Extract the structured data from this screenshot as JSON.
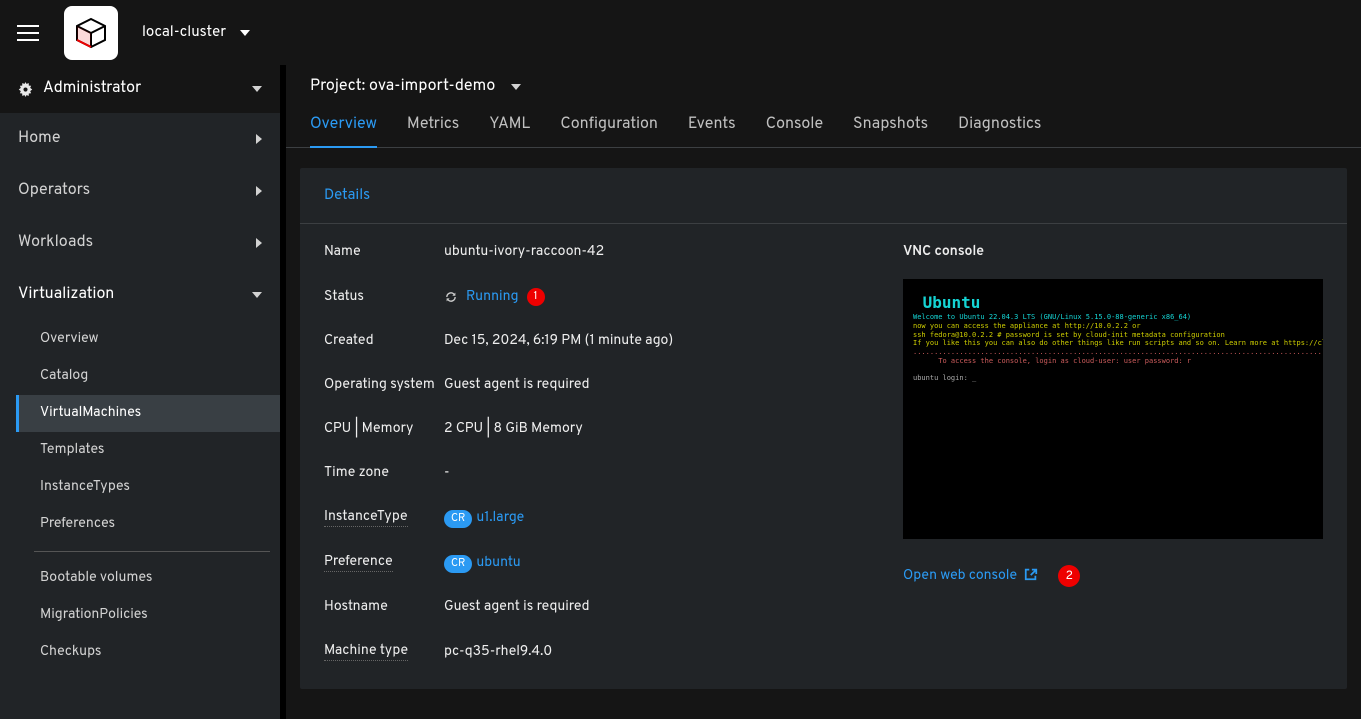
{
  "header": {
    "cluster": "local-cluster"
  },
  "sidebar": {
    "role": "Administrator",
    "top": [
      {
        "label": "Home"
      },
      {
        "label": "Operators"
      },
      {
        "label": "Workloads"
      }
    ],
    "virtualization": {
      "label": "Virtualization",
      "items": [
        "Overview",
        "Catalog",
        "VirtualMachines",
        "Templates",
        "InstanceTypes",
        "Preferences"
      ],
      "items2": [
        "Bootable volumes",
        "MigrationPolicies",
        "Checkups"
      ]
    }
  },
  "project": {
    "prefix": "Project: ",
    "name": "ova-import-demo"
  },
  "tabs": [
    "Overview",
    "Metrics",
    "YAML",
    "Configuration",
    "Events",
    "Console",
    "Snapshots",
    "Diagnostics"
  ],
  "details": {
    "heading": "Details",
    "labels": {
      "name": "Name",
      "status": "Status",
      "created": "Created",
      "os": "Operating system",
      "cpumem": "CPU | Memory",
      "tz": "Time zone",
      "instancetype": "InstanceType",
      "preference": "Preference",
      "hostname": "Hostname",
      "machinetype": "Machine type"
    },
    "values": {
      "name": "ubuntu-ivory-raccoon-42",
      "status": "Running",
      "created": "Dec 15, 2024, 6:19 PM (1 minute ago)",
      "os": "Guest agent is required",
      "cpumem": "2 CPU | 8 GiB Memory",
      "tz": "-",
      "instancetype": "u1.large",
      "preference": "ubuntu",
      "hostname": "Guest agent is required",
      "machinetype": "pc-q35-rhel9.4.0"
    },
    "cr_badge": "CR",
    "status_badge": "1"
  },
  "console": {
    "title": "VNC console",
    "open_label": "Open web console",
    "open_badge": "2",
    "boot_lines": {
      "logo": " Ubuntu",
      "cyan1": "Welcome to Ubuntu 22.04.3 LTS (GNU/Linux 5.15.0-88-generic x86_64)",
      "yellow1": "now you can access the appliance at http://10.0.2.2 or",
      "yellow2": "ssh fedora@10.0.2.2 # password is set by cloud-init metadata configuration",
      "yellow3": "If you like this you can also do other things like run scripts and so on. Learn more at https://cloudinit.readthedocs.io",
      "red1": "....................................................................................................",
      "red2": "      To access the console, login as cloud-user: user password: r",
      "grey1": "ubuntu login: _"
    }
  }
}
